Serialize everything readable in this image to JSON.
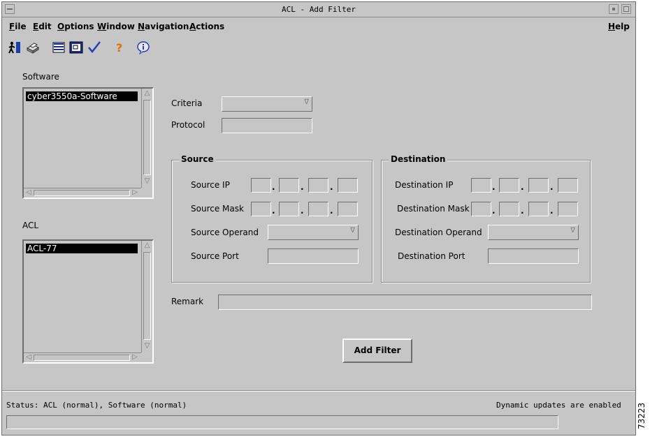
{
  "window": {
    "title": "ACL - Add Filter"
  },
  "menubar": {
    "items": [
      {
        "label": "File",
        "mnemonic": "F",
        "rest": "ile"
      },
      {
        "label": "Edit",
        "mnemonic": "E",
        "rest": "dit"
      },
      {
        "label": "Options",
        "mnemonic": "O",
        "rest": "ptions"
      },
      {
        "label": "Window",
        "mnemonic": "W",
        "rest": "indow"
      },
      {
        "label": "Navigation",
        "mnemonic": "N",
        "rest": "avigation"
      },
      {
        "label": "Actions",
        "mnemonic": "A",
        "rest": "ctions"
      }
    ],
    "help": {
      "label": "Help",
      "mnemonic": "H",
      "rest": "elp"
    }
  },
  "toolbar": {
    "icons": [
      "exit-icon",
      "printer-icon",
      "list-icon",
      "monitor-icon",
      "checkmark-icon",
      "help-icon",
      "info-icon"
    ]
  },
  "software": {
    "label": "Software",
    "items": [
      "cyber3550a-Software"
    ]
  },
  "acl": {
    "label": "ACL",
    "items": [
      "ACL-77"
    ]
  },
  "criteria": {
    "label": "Criteria",
    "value": ""
  },
  "protocol": {
    "label": "Protocol",
    "value": ""
  },
  "source": {
    "title": "Source",
    "ip_label": "Source IP",
    "mask_label": "Source Mask",
    "operand_label": "Source Operand",
    "port_label": "Source Port"
  },
  "destination": {
    "title": "Destination",
    "ip_label": "Destination IP",
    "mask_label": "Destination Mask",
    "operand_label": "Destination Operand",
    "port_label": "Destination Port"
  },
  "remark": {
    "label": "Remark",
    "value": ""
  },
  "add_filter": {
    "label": "Add Filter"
  },
  "status": {
    "text": "Status: ACL (normal), Software (normal)",
    "updates": "Dynamic updates are enabled"
  },
  "figure_id": "73223"
}
